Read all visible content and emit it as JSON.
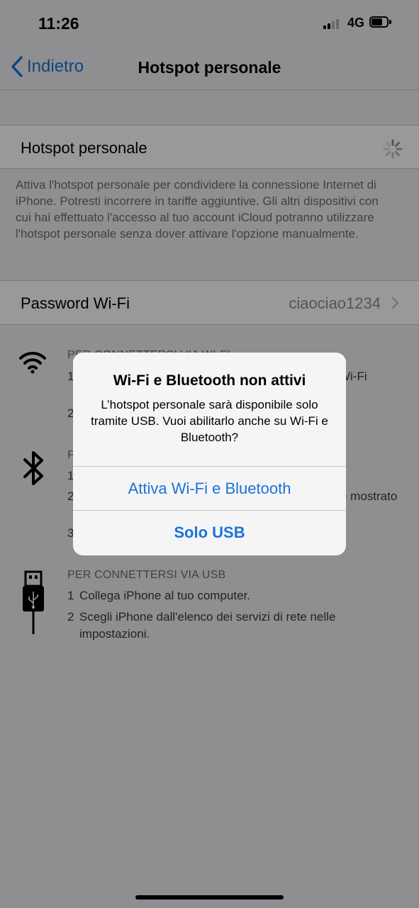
{
  "statusbar": {
    "time": "11:26",
    "network": "4G"
  },
  "nav": {
    "back_label": "Indietro",
    "title": "Hotspot personale"
  },
  "hotspot_cell": {
    "label": "Hotspot personale"
  },
  "hotspot_footer": "Attiva l'hotspot personale per condividere la connessione Internet di iPhone. Potresti incorrere in tariffe aggiuntive. Gli altri dispositivi con cui hai effettuato l'accesso al tuo account iCloud potranno utilizzare l'hotspot personale senza dover attivare l'opzione manualmente.",
  "password_cell": {
    "label": "Password Wi-Fi",
    "value": "ciaociao1234"
  },
  "wifi_section": {
    "title": "PER CONNETTERSI VIA WI-FI",
    "step1_num": "1",
    "step1_tail": "ni Wi-Fi",
    "step2_num": "2"
  },
  "bt_section": {
    "title_start": "P",
    "step1_num": "1",
    "step2_num": "2",
    "step2_tail": "e mostrato",
    "step3_num": "3"
  },
  "usb_section": {
    "title": "PER CONNETTERSI VIA USB",
    "steps": [
      {
        "num": "1",
        "text": "Collega iPhone al tuo computer."
      },
      {
        "num": "2",
        "text": "Scegli iPhone dall'elenco dei servizi di rete nelle impostazioni."
      }
    ]
  },
  "alert": {
    "title": "Wi-Fi e Bluetooth non attivi",
    "message": "L’hotspot personale sarà disponibile solo tramite USB. Vuoi abilitarlo anche su Wi-Fi e Bluetooth?",
    "primary_button": "Attiva Wi-Fi e Bluetooth",
    "secondary_button": "Solo USB"
  },
  "colors": {
    "accent": "#1a73d9",
    "background": "#efeff4",
    "dim_overlay": "rgba(0,0,0,0.40)"
  },
  "icons": [
    "chevron-left-icon",
    "spinner-icon",
    "chevron-right-icon",
    "wifi-icon",
    "bluetooth-icon",
    "usb-icon"
  ]
}
